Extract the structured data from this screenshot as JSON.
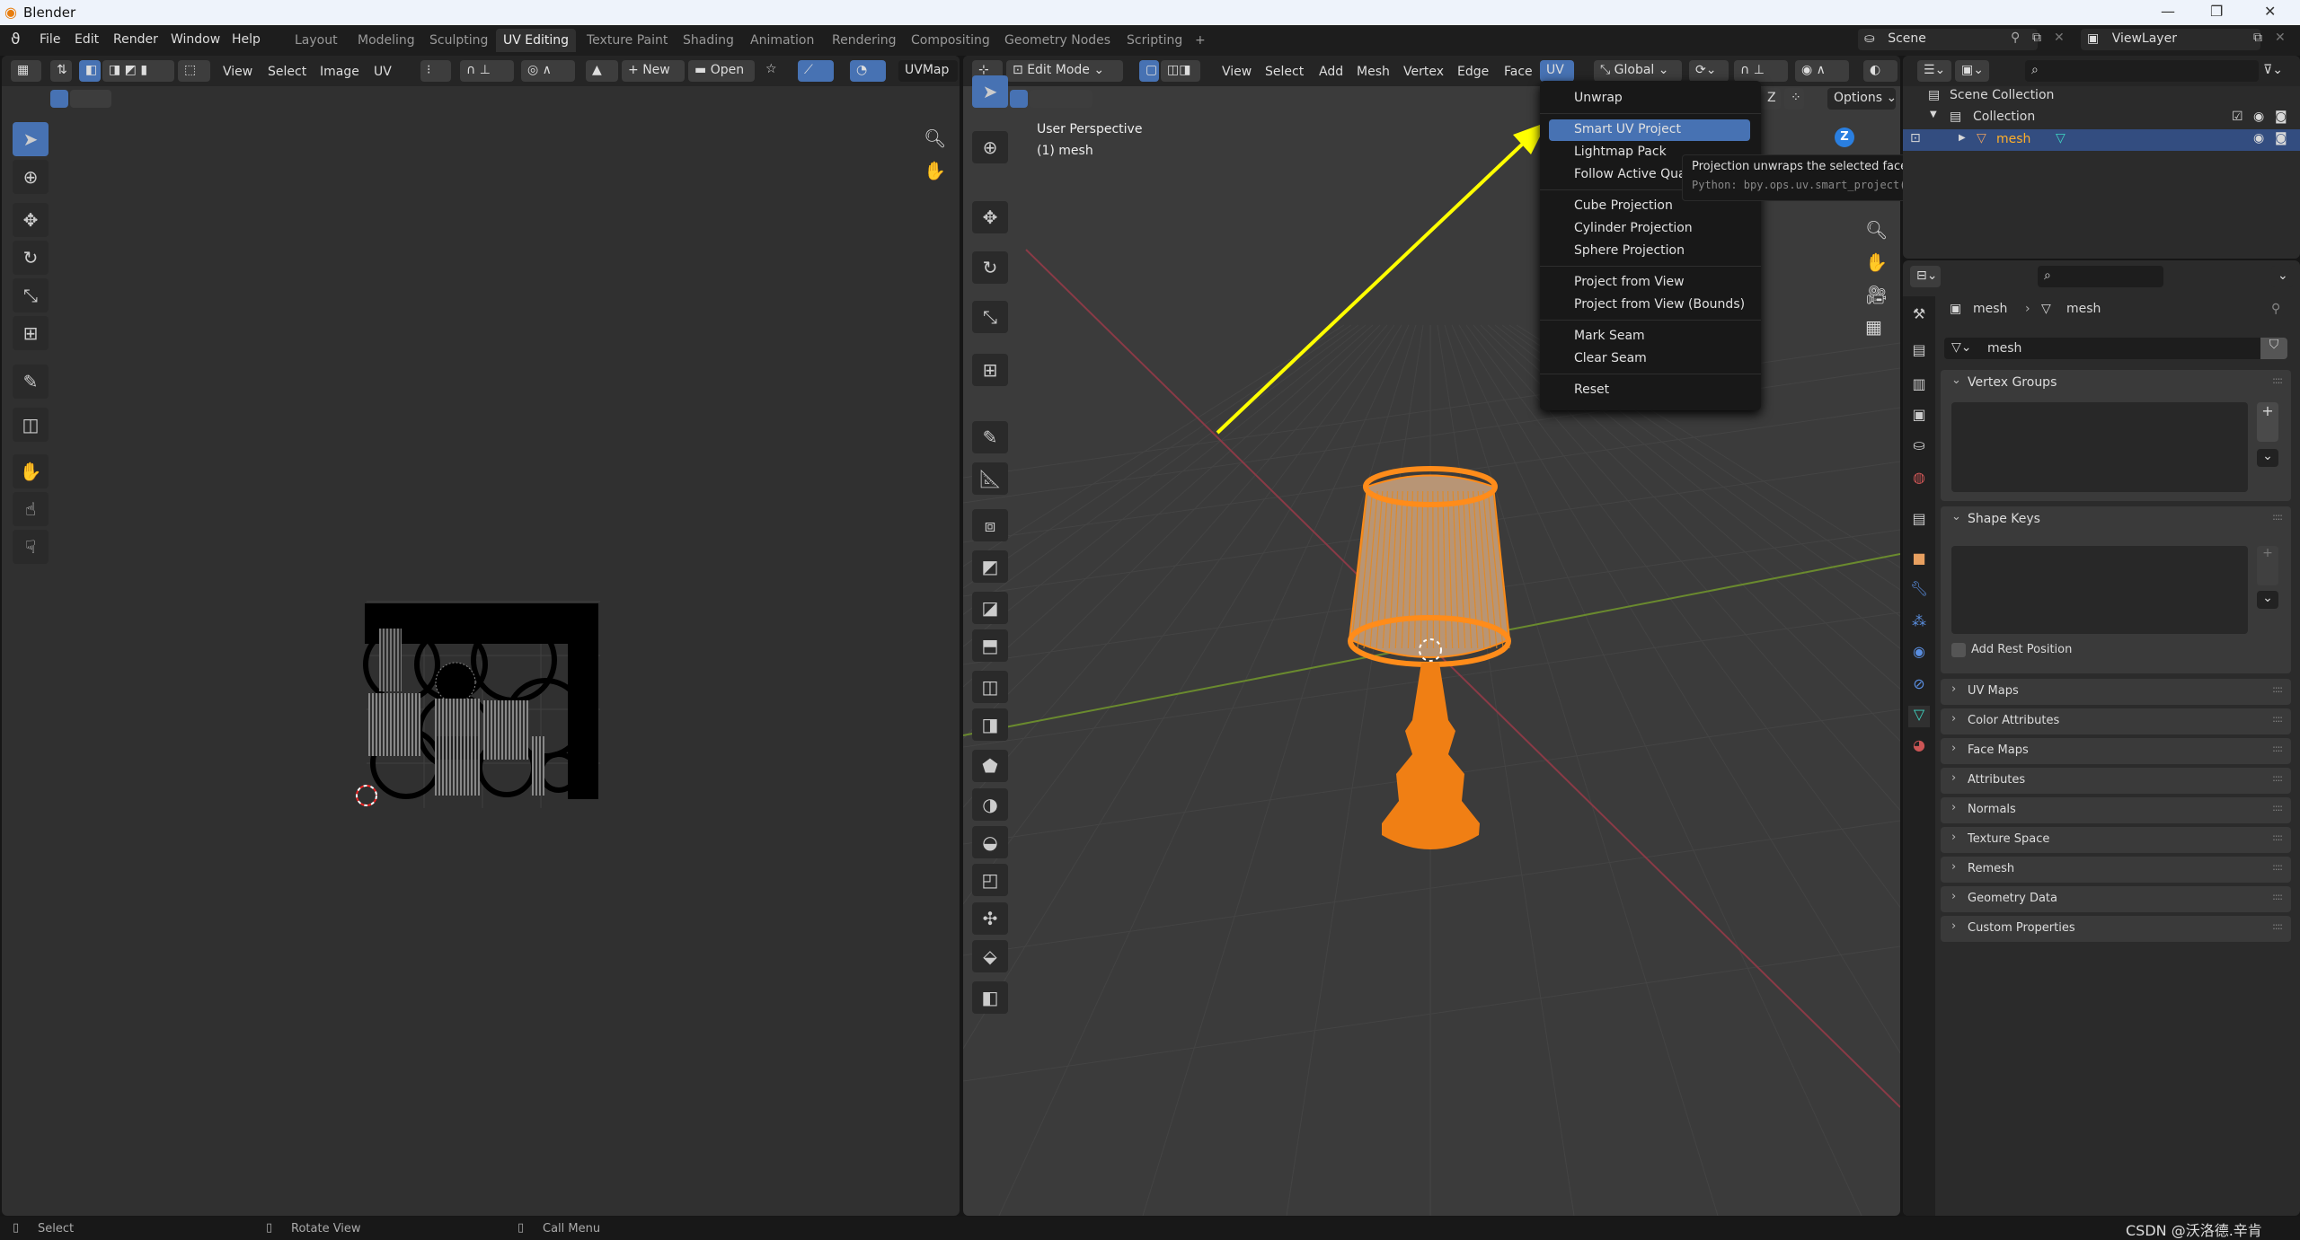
{
  "window": {
    "title": "Blender",
    "controls": [
      "—",
      "❐",
      "✕"
    ]
  },
  "menubar": {
    "items": [
      "File",
      "Edit",
      "Render",
      "Window",
      "Help"
    ]
  },
  "workspaces": {
    "tabs": [
      "Layout",
      "Modeling",
      "Sculpting",
      "UV Editing",
      "Texture Paint",
      "Shading",
      "Animation",
      "Rendering",
      "Compositing",
      "Geometry Nodes",
      "Scripting"
    ],
    "active": "UV Editing",
    "add": "+"
  },
  "scene": {
    "name": "Scene",
    "view_layer": "ViewLayer"
  },
  "uv_editor": {
    "menus": [
      "View",
      "Select",
      "Image",
      "UV"
    ],
    "new_label": "New",
    "open_label": "Open",
    "uvmap": "UVMap"
  },
  "viewport": {
    "mode": "Edit Mode",
    "menus": [
      "View",
      "Select",
      "Add",
      "Mesh",
      "Vertex",
      "Edge",
      "Face",
      "UV"
    ],
    "active_menu": "UV",
    "orientation": "Global",
    "options_label": "Options",
    "axis_z": "Z",
    "overlay_title": "User Perspective",
    "overlay_object": "(1) mesh"
  },
  "uv_menu": {
    "items": [
      {
        "label": "Unwrap"
      },
      {
        "sep": true
      },
      {
        "label": "Smart UV Project",
        "highlighted": true
      },
      {
        "label": "Lightmap Pack"
      },
      {
        "label": "Follow Active Quads"
      },
      {
        "sep": true
      },
      {
        "label": "Cube Projection"
      },
      {
        "label": "Cylinder Projection"
      },
      {
        "label": "Sphere Projection"
      },
      {
        "sep": true
      },
      {
        "label": "Project from View"
      },
      {
        "label": "Project from View (Bounds)"
      },
      {
        "sep": true
      },
      {
        "label": "Mark Seam"
      },
      {
        "label": "Clear Seam"
      },
      {
        "sep": true
      },
      {
        "label": "Reset"
      }
    ]
  },
  "tooltip": {
    "description": "Projection unwraps the selected faces of mesh objects.",
    "python": "Python: bpy.ops.uv.smart_project()"
  },
  "outliner": {
    "scene_collection": "Scene Collection",
    "collection": "Collection",
    "object": "mesh"
  },
  "properties": {
    "breadcrumb": [
      "mesh",
      "mesh"
    ],
    "datablock": "mesh",
    "vertex_groups": "Vertex Groups",
    "shape_keys": "Shape Keys",
    "add_rest_position": "Add Rest Position",
    "collapsed_panels": [
      "UV Maps",
      "Color Attributes",
      "Face Maps",
      "Attributes",
      "Normals",
      "Texture Space",
      "Remesh",
      "Geometry Data",
      "Custom Properties"
    ]
  },
  "statusbar": {
    "items": [
      "Select",
      "Rotate View",
      "Call Menu"
    ],
    "watermark": "CSDN @沃洛德.辛肯"
  },
  "colors": {
    "accent": "#4772b3",
    "selection": "#ff8c1a",
    "annotation_arrow": "#ffff00"
  }
}
